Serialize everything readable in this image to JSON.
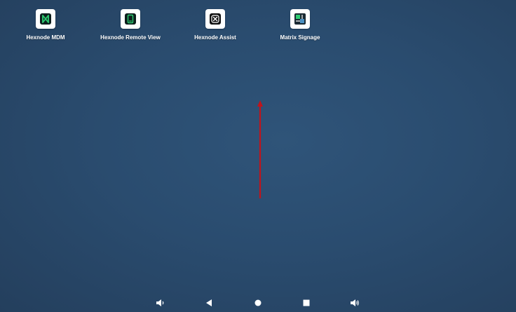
{
  "home": {
    "apps": [
      {
        "label": "Hexnode MDM",
        "icon": "hexnode-mdm-icon"
      },
      {
        "label": "Hexnode Remote View",
        "icon": "hexnode-remote-view-icon"
      },
      {
        "label": "Hexnode Assist",
        "icon": "hexnode-assist-icon"
      },
      {
        "label": "Matrix Signage",
        "icon": "matrix-signage-icon"
      }
    ],
    "gesture_hint": {
      "direction": "up",
      "color": "#c0141c"
    }
  },
  "navbar": {
    "buttons": [
      "volume-down-icon",
      "back-icon",
      "home-icon",
      "recents-icon",
      "volume-up-icon"
    ]
  },
  "colors": {
    "background": "#2a4c6f",
    "hexnode_green": "#2ecc71",
    "arrow_red": "#c0141c"
  }
}
